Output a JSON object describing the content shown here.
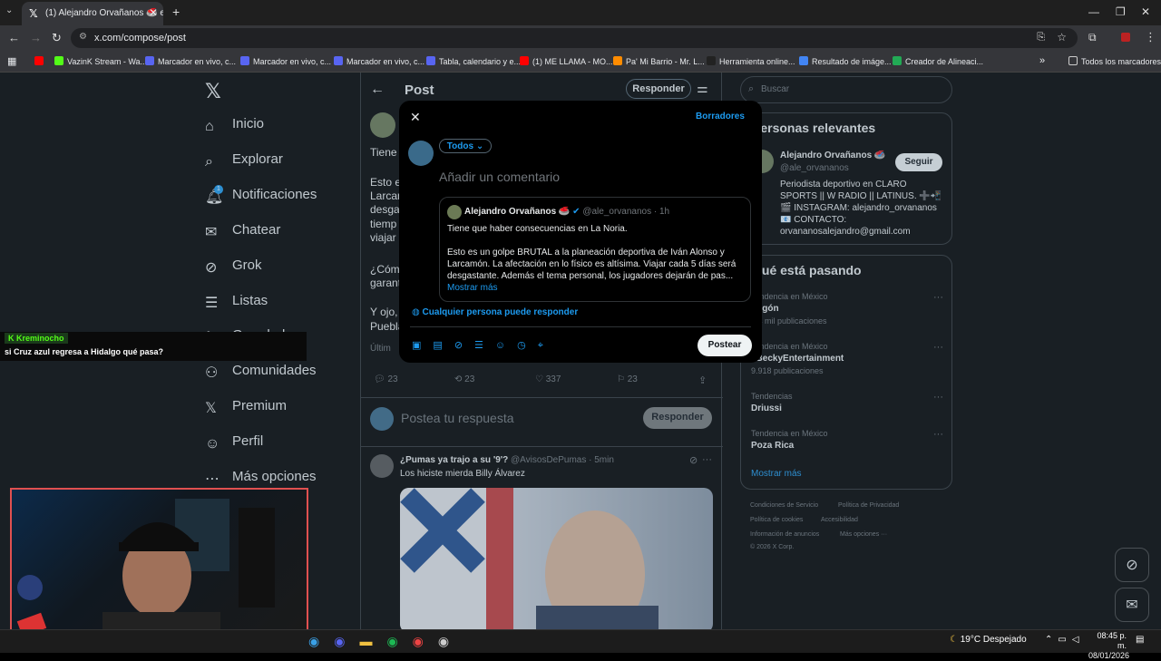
{
  "browser": {
    "tab_title": "(1) Alejandro Orvañanos 🥌 en",
    "url": "x.com/compose/post",
    "bookmarks": [
      {
        "label": "VazinK Stream - Wa...",
        "color": "#53fc18"
      },
      {
        "label": "Marcador en vivo, c...",
        "color": "#5865f2"
      },
      {
        "label": "Marcador en vivo, c...",
        "color": "#5865f2"
      },
      {
        "label": "Marcador en vivo, c...",
        "color": "#5865f2"
      },
      {
        "label": "Tabla, calendario y e...",
        "color": "#5865f2"
      },
      {
        "label": "(1) ME LLAMA - MO...",
        "color": "#ff0000"
      },
      {
        "label": "Pa' Mi Barrio - Mr. L...",
        "color": "#ff8c00"
      },
      {
        "label": "Herramienta online...",
        "color": "#222222"
      },
      {
        "label": "Resultado de imáge...",
        "color": "#4285f4"
      },
      {
        "label": "Creador de Alineaci...",
        "color": "#22aa55"
      }
    ],
    "all_bookmarks": "Todos los marcadores"
  },
  "nav": {
    "items": [
      "Inicio",
      "Explorar",
      "Notificaciones",
      "Chatear",
      "Grok",
      "Listas",
      "Guardados",
      "Comunidades",
      "Premium",
      "Perfil",
      "Más opciones"
    ],
    "notif_count": "1"
  },
  "post": {
    "header": "Post",
    "reply_button": "Responder",
    "visible_text": [
      "Tiene",
      "Esto e",
      "Larcam",
      "desga",
      "tiemp",
      "viajar",
      "¿Cóm",
      "garant",
      "Y ojo,",
      "Puebla",
      "Últim"
    ],
    "stats": {
      "replies": "23",
      "reposts": "23",
      "likes": "337",
      "bookmarks": "23"
    },
    "reply_placeholder": "Postea tu respuesta",
    "reply_submit": "Responder"
  },
  "feed_post": {
    "name": "¿Pumas ya trajo a su '9'?",
    "handle": "@AvisosDePumas · 5min",
    "text": "Los hiciste mierda Billy Álvarez"
  },
  "modal": {
    "drafts": "Borradores",
    "audience": "Todos",
    "placeholder": "Añadir un comentario",
    "quoted": {
      "name": "Alejandro Orvañanos 🥌",
      "handle": "@ale_orvananos · 1h",
      "line1": "Tiene que haber consecuencias en La Noria.",
      "line2": "Esto es un golpe BRUTAL a la planeación deportiva de Iván Alonso y Larcamón. La afectación en lo físico es altísima. Viajar cada 5 días será desgastante. Además el tema personal, los jugadores dejarán de pas...",
      "more": "Mostrar más"
    },
    "reply_setting": "Cualquier persona puede responder",
    "post_button": "Postear"
  },
  "search": {
    "placeholder": "Buscar"
  },
  "relevant": {
    "title": "Personas relevantes",
    "name": "Alejandro Orvañanos 🥌",
    "handle": "@ale_orvananos",
    "follow": "Seguir",
    "bio": "Periodista deportivo en CLARO SPORTS || W RADIO || LATINUS. ➕📲🎬 INSTAGRAM: alejandro_orvananos 📧 CONTACTO: orvananosalejandro@gmail.com"
  },
  "trends": {
    "title": "Qué está pasando",
    "items": [
      {
        "context": "Tendencia en México",
        "name": "Pegón",
        "count": "3,4 mil publicaciones"
      },
      {
        "context": "Tendencia en México",
        "name": "#BeckyEntertainment",
        "count": "9.918 publicaciones"
      },
      {
        "context": "Tendencias",
        "name": "Driussi",
        "count": ""
      },
      {
        "context": "Tendencia en México",
        "name": "Poza Rica",
        "count": ""
      }
    ],
    "more": "Mostrar más"
  },
  "footer": {
    "links": [
      "Condiciones de Servicio",
      "Política de Privacidad",
      "Política de cookies",
      "Accesibilidad",
      "Información de anuncios",
      "Más opciones ···"
    ],
    "copyright": "© 2026 X Corp."
  },
  "stream": {
    "chat_user": "Kreminocho",
    "chat_message": "si Cruz azul regresa a Hidalgo qué pasa?"
  },
  "taskbar": {
    "weather": "19°C  Despejado",
    "time": "08:45 p. m.",
    "date": "08/01/2026"
  }
}
